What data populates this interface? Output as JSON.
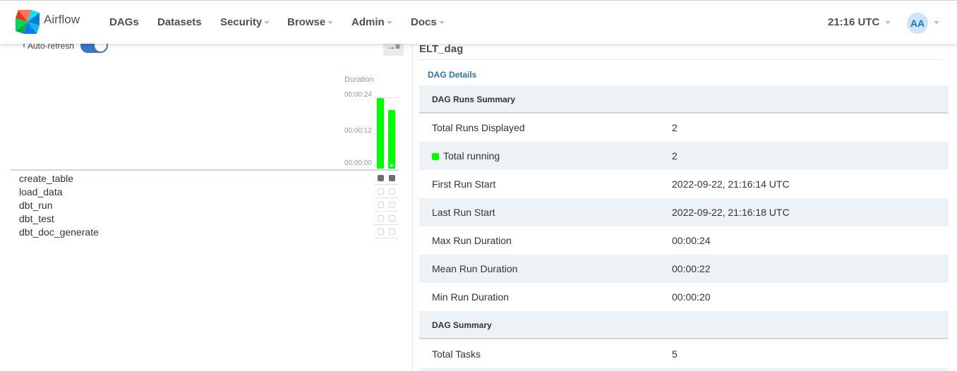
{
  "navbar": {
    "brand": "Airflow",
    "items": [
      {
        "label": "DAGs",
        "dropdown": false
      },
      {
        "label": "Datasets",
        "dropdown": false
      },
      {
        "label": "Security",
        "dropdown": true
      },
      {
        "label": "Browse",
        "dropdown": true
      },
      {
        "label": "Admin",
        "dropdown": true
      },
      {
        "label": "Docs",
        "dropdown": true
      }
    ],
    "clock": "21:16 UTC",
    "avatar": "AA"
  },
  "grid": {
    "auto_refresh_label": "Auto-refresh",
    "auto_refresh_on": true,
    "collapse_icon": "→≡",
    "duration_label": "Duration",
    "ticks": [
      "00:00:24",
      "00:00:12",
      "00:00:00"
    ],
    "runs": [
      {
        "duration_s": 24,
        "state": "running"
      },
      {
        "duration_s": 20,
        "state": "running"
      }
    ],
    "tasks": [
      {
        "name": "create_table",
        "cells": [
          "filled",
          "filled"
        ]
      },
      {
        "name": "load_data",
        "cells": [
          "empty",
          "empty"
        ]
      },
      {
        "name": "dbt_run",
        "cells": [
          "empty",
          "empty"
        ]
      },
      {
        "name": "dbt_test",
        "cells": [
          "empty",
          "empty"
        ]
      },
      {
        "name": "dbt_doc_generate",
        "cells": [
          "empty",
          "empty"
        ]
      }
    ],
    "running_color": "#00ff00",
    "queued_color": "#6d6d6d"
  },
  "details": {
    "dag_id": "ELT_dag",
    "details_link": "DAG Details",
    "runs_summary_title": "DAG Runs Summary",
    "total_runs_label": "Total Runs Displayed",
    "total_runs_value": "2",
    "total_running_label": "Total running",
    "total_running_value": "2",
    "first_run_label": "First Run Start",
    "first_run_value": "2022-09-22, 21:16:14 UTC",
    "last_run_label": "Last Run Start",
    "last_run_value": "2022-09-22, 21:16:18 UTC",
    "max_label": "Max Run Duration",
    "max_value": "00:00:24",
    "mean_label": "Mean Run Duration",
    "mean_value": "00:00:22",
    "min_label": "Min Run Duration",
    "min_value": "00:00:20",
    "dag_summary_title": "DAG Summary",
    "total_tasks_label": "Total Tasks",
    "total_tasks_value": "5"
  }
}
